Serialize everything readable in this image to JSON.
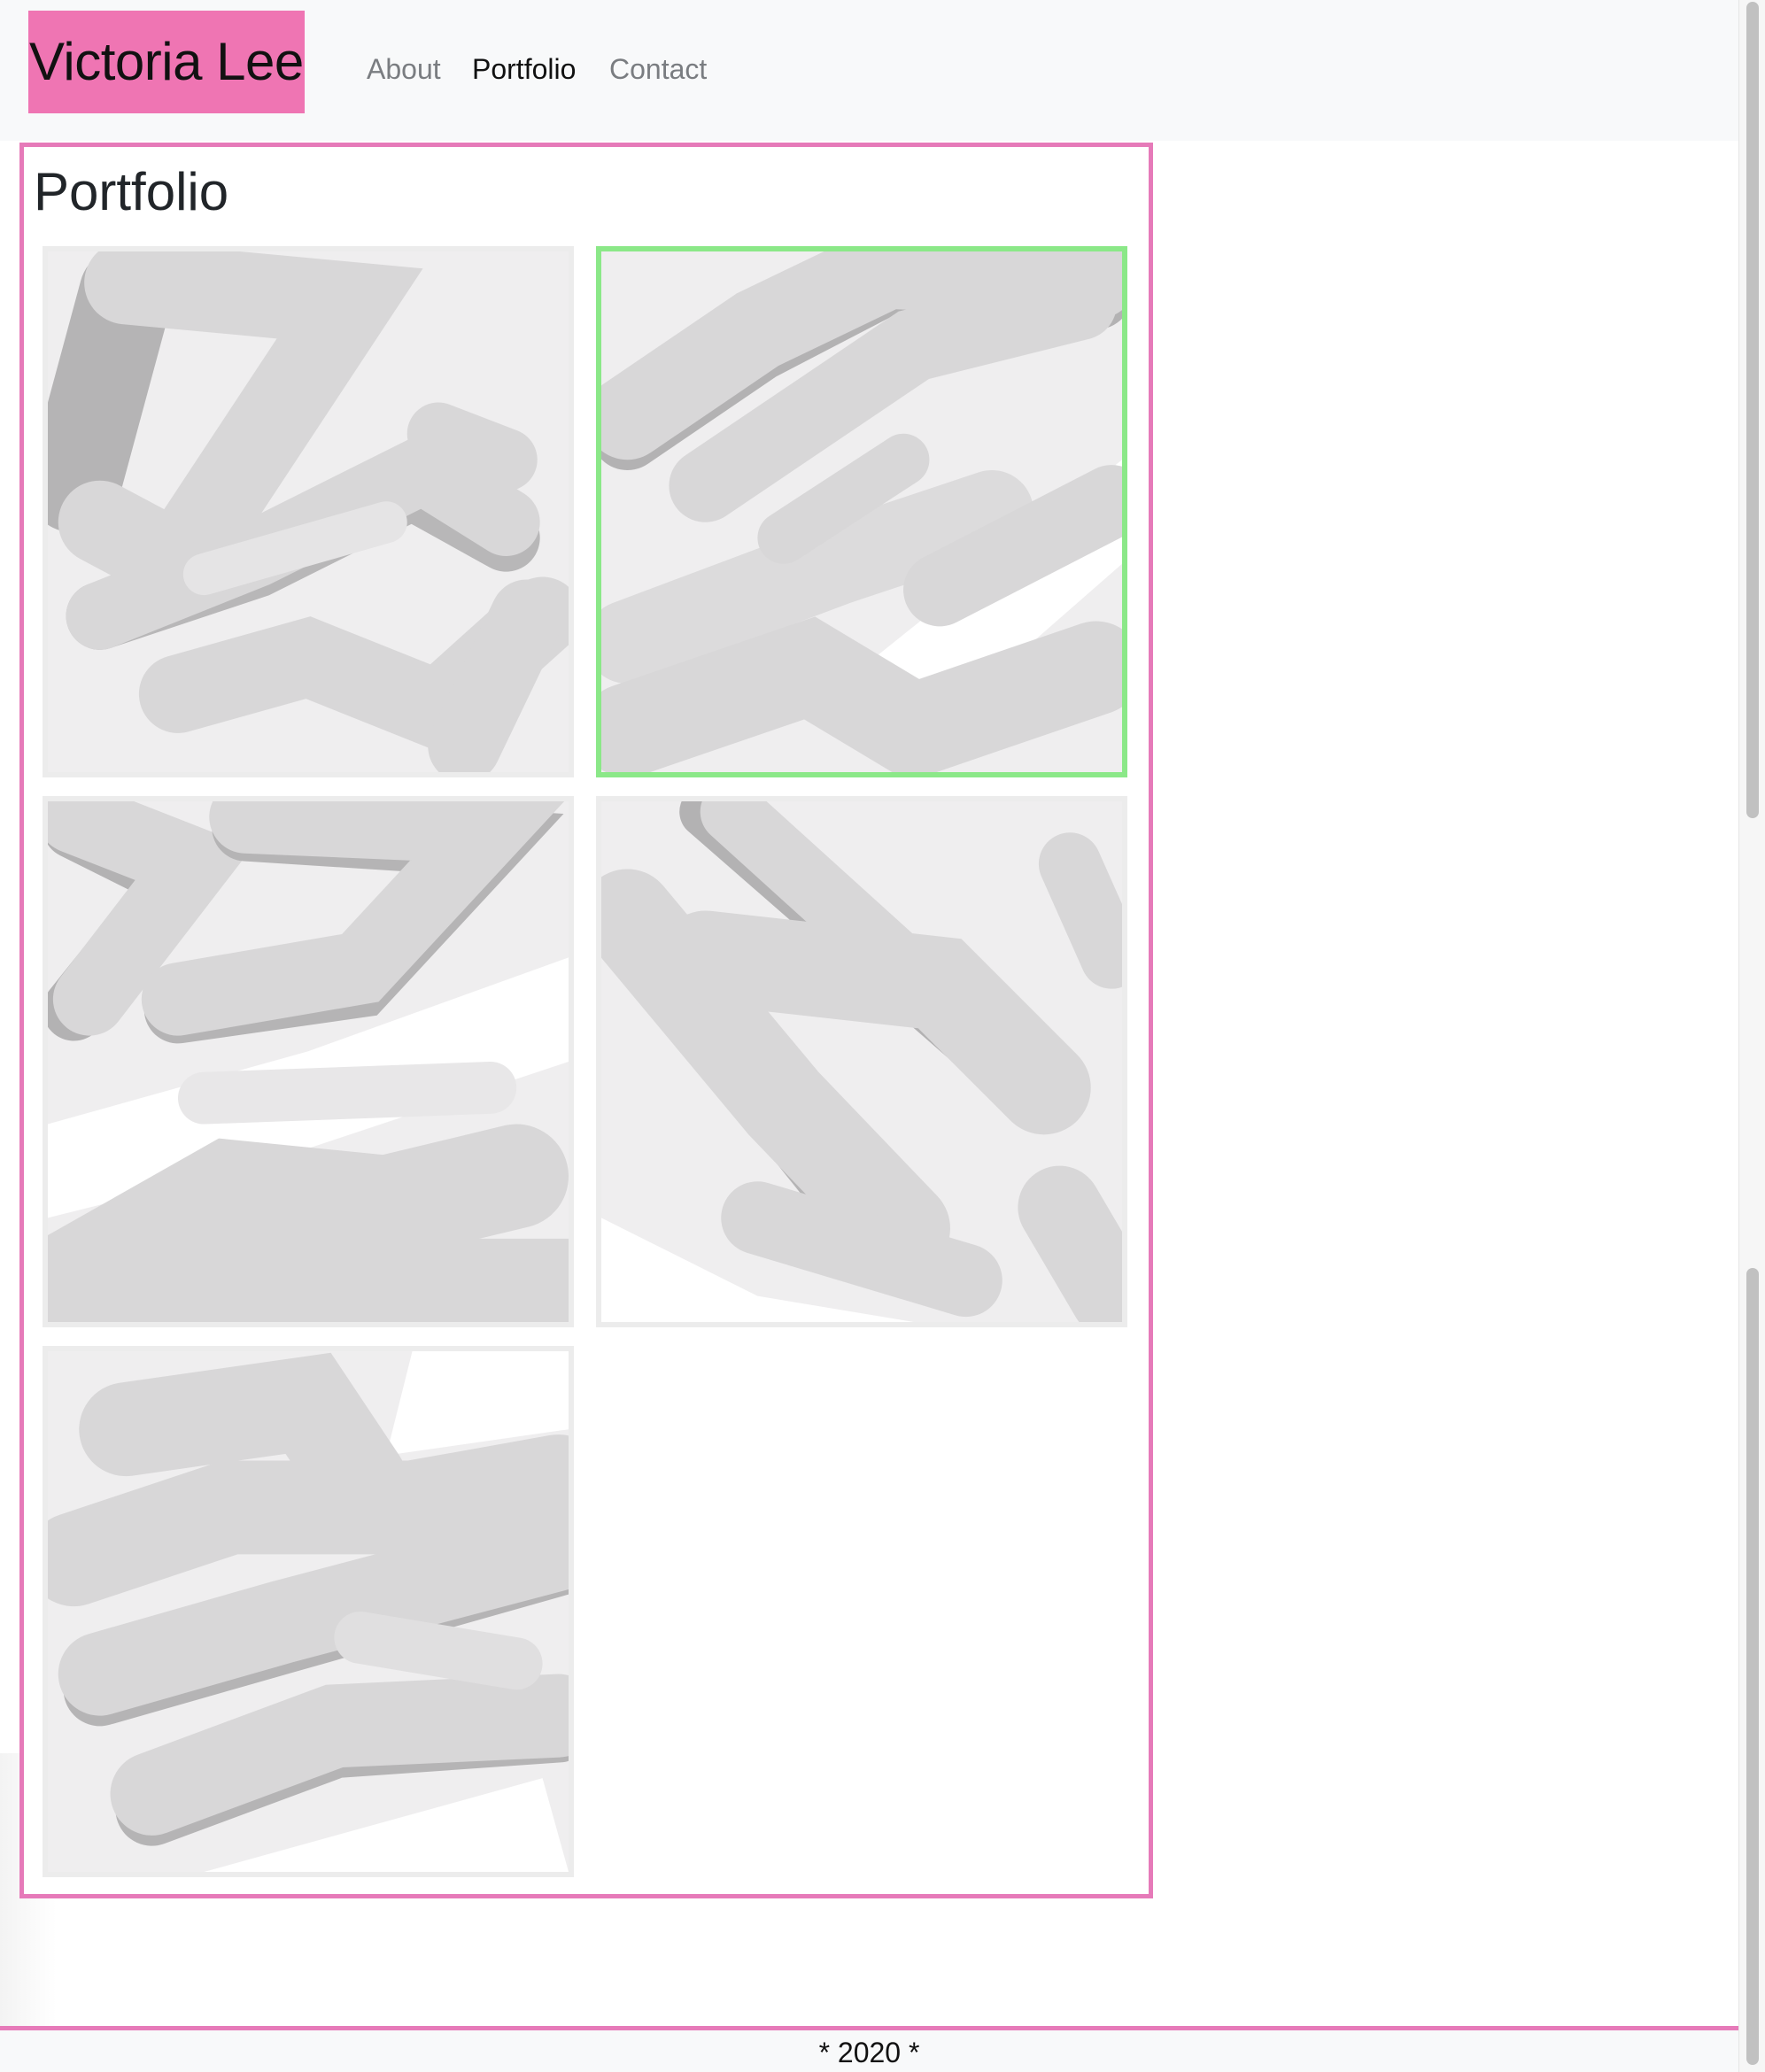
{
  "site": {
    "brand": "Victoria Lee",
    "brand_color": "#ef75b3"
  },
  "nav": {
    "items": [
      {
        "label": "About",
        "active": false
      },
      {
        "label": "Portfolio",
        "active": true
      },
      {
        "label": "Contact",
        "active": false
      }
    ]
  },
  "main": {
    "title": "Portfolio",
    "frame_color": "#e67ab9",
    "selected_color": "#8be888",
    "tiles": [
      {
        "name": "portfolio-image-1",
        "selected": false
      },
      {
        "name": "portfolio-image-2",
        "selected": true
      },
      {
        "name": "portfolio-image-3",
        "selected": false
      },
      {
        "name": "portfolio-image-4",
        "selected": false
      },
      {
        "name": "portfolio-image-5",
        "selected": false
      }
    ]
  },
  "footer": {
    "text": "* 2020 *"
  }
}
